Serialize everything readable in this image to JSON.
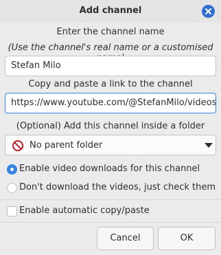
{
  "window": {
    "title": "Add channel"
  },
  "name_section": {
    "label": "Enter the channel name",
    "hint": "(Use the channel's real name or a customised name)",
    "value": "Stefan Milo"
  },
  "url_section": {
    "label": "Copy and paste a link to the channel",
    "value": "https://www.youtube.com/@StefanMilo/videos"
  },
  "folder_section": {
    "label": "(Optional) Add this channel inside a folder",
    "selected": "No parent folder"
  },
  "options": {
    "radio_download": "Enable video downloads for this channel",
    "radio_check": "Don't download the videos, just check them",
    "radio_selected": "download",
    "checkbox_copy": "Enable automatic copy/paste",
    "checkbox_checked": false
  },
  "buttons": {
    "cancel": "Cancel",
    "ok": "OK"
  },
  "colors": {
    "accent": "#3584e4",
    "close": "#2f6fd0",
    "no_entry": "#c01c28"
  },
  "icons": {
    "close": "close-icon",
    "folder": "no-entry-icon",
    "dropdown": "dropdown-arrow-icon"
  }
}
